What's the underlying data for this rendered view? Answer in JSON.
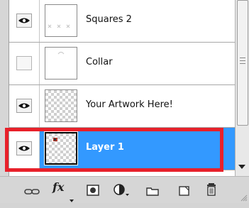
{
  "layers": [
    {
      "name": "Squares 2",
      "visible": true,
      "thumbnail": "squares-preview",
      "selected": false
    },
    {
      "name": "Collar",
      "visible": false,
      "thumbnail": "collar-preview",
      "selected": false
    },
    {
      "name": "Your Artwork Here!",
      "visible": true,
      "thumbnail": "transparent",
      "selected": false
    },
    {
      "name": "Layer 1",
      "visible": true,
      "thumbnail": "transparent-with-mark",
      "selected": true
    }
  ],
  "colors": {
    "selection": "#3399ff",
    "highlight_box": "#e8202a",
    "panel_bg": "#d6d6d6"
  },
  "toolbar": {
    "fx_label": "fx",
    "icons": [
      "link-icon",
      "fx-icon",
      "mask-icon",
      "adjustment-icon",
      "group-folder-icon",
      "new-layer-icon",
      "trash-icon"
    ]
  }
}
